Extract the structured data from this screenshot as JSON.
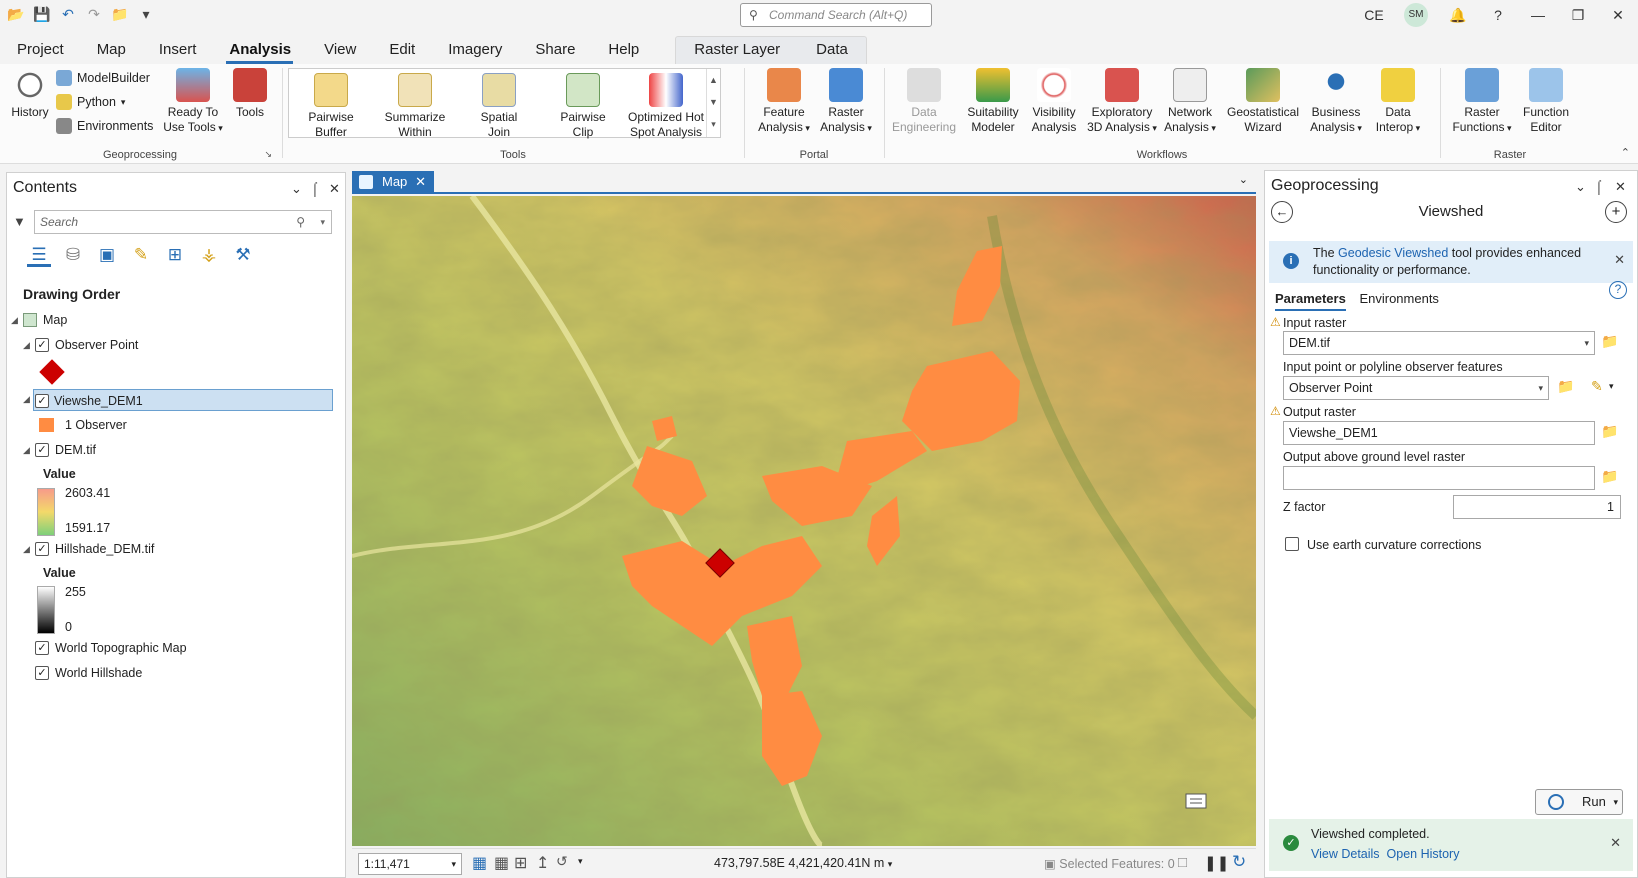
{
  "command_search": {
    "placeholder": "Command Search (Alt+Q)"
  },
  "titlebar": {
    "user_initials": "CE",
    "avatar": "SM"
  },
  "tabs": [
    "Project",
    "Map",
    "Insert",
    "Analysis",
    "View",
    "Edit",
    "Imagery",
    "Share",
    "Help"
  ],
  "context_tabs": [
    "Raster Layer",
    "Data"
  ],
  "ribbon": {
    "geoprocessing": {
      "label": "Geoprocessing",
      "history": "History",
      "modelbuilder": "ModelBuilder",
      "python": "Python",
      "environments": "Environments",
      "ready_tools": [
        "Ready To",
        "Use Tools"
      ],
      "tools": "Tools"
    },
    "tools": {
      "label": "Tools",
      "items": [
        [
          "Pairwise",
          "Buffer"
        ],
        [
          "Summarize",
          "Within"
        ],
        [
          "Spatial",
          "Join"
        ],
        [
          "Pairwise",
          "Clip"
        ],
        [
          "Optimized Hot",
          "Spot Analysis"
        ]
      ]
    },
    "portal": {
      "label": "Portal",
      "items": [
        [
          "Feature",
          "Analysis"
        ],
        [
          "Raster",
          "Analysis"
        ]
      ]
    },
    "workflows": {
      "label": "Workflows",
      "items": [
        [
          "Data",
          "Engineering"
        ],
        [
          "Suitability",
          "Modeler"
        ],
        [
          "Visibility",
          "Analysis"
        ],
        [
          "Exploratory",
          "3D Analysis"
        ],
        [
          "Network",
          "Analysis"
        ],
        [
          "Geostatistical",
          "Wizard"
        ],
        [
          "Business",
          "Analysis"
        ],
        [
          "Data",
          "Interop"
        ]
      ]
    },
    "raster": {
      "label": "Raster",
      "items": [
        [
          "Raster",
          "Functions"
        ],
        [
          "Function",
          "Editor"
        ]
      ]
    }
  },
  "contents": {
    "title": "Contents",
    "search_placeholder": "Search",
    "drawing_order": "Drawing Order",
    "map": "Map",
    "layers": {
      "observer_point": "Observer Point",
      "viewshed": "Viewshe_DEM1",
      "viewshed_class": "1 Observer",
      "dem": "DEM.tif",
      "dem_value": "Value",
      "dem_max": "2603.41",
      "dem_min": "1591.17",
      "hillshade": "Hillshade_DEM.tif",
      "hill_value": "Value",
      "hill_max": "255",
      "hill_min": "0",
      "topo": "World Topographic Map",
      "world_hillshade": "World Hillshade"
    }
  },
  "map_tab": "Map",
  "status": {
    "scale": "1:11,471",
    "coords": "473,797.58E 4,421,420.41N m",
    "selected": "Selected Features: 0"
  },
  "gp": {
    "title": "Geoprocessing",
    "tool": "Viewshed",
    "banner_pre": "The",
    "banner_link": "Geodesic Viewshed",
    "banner_post": "tool provides enhanced functionality or performance.",
    "tabs": [
      "Parameters",
      "Environments"
    ],
    "input_raster_label": "Input raster",
    "input_raster": "DEM.tif",
    "observer_label": "Input point or polyline observer features",
    "observer": "Observer Point",
    "output_label": "Output raster",
    "output": "Viewshe_DEM1",
    "agl_label": "Output above ground level raster",
    "agl": "",
    "z_label": "Z factor",
    "z": "1",
    "curv_label": "Use earth curvature corrections",
    "run": "Run",
    "done": "Viewshed completed.",
    "view_details": "View Details",
    "open_history": "Open History"
  },
  "colors": {
    "accent": "#2a6fb5",
    "viewshed": "#ff8c42",
    "observer": "#cc0000"
  }
}
